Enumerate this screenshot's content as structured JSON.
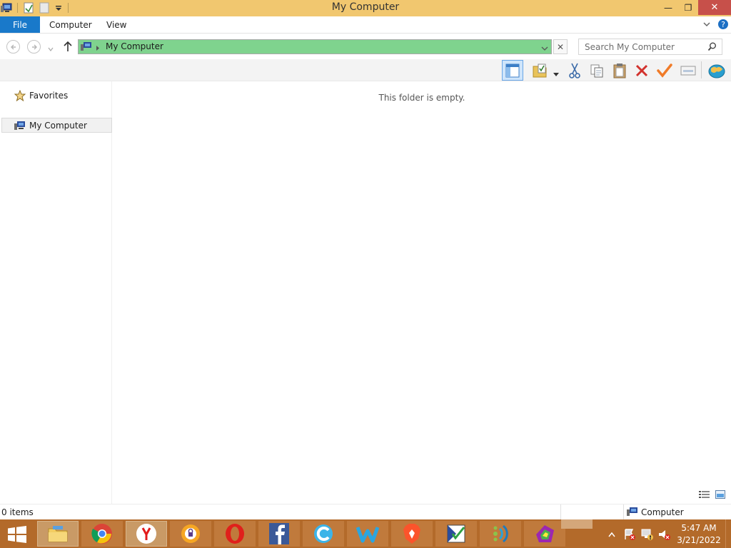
{
  "window": {
    "title": "My Computer",
    "minimize": "—",
    "restore": "❐",
    "close": "✕"
  },
  "ribbon": {
    "tabs": [
      "File",
      "Computer",
      "View"
    ]
  },
  "address": {
    "path": "My Computer",
    "clear": "✕"
  },
  "search": {
    "placeholder": "Search My Computer"
  },
  "nav_pane": {
    "items": [
      "Favorites",
      "My Computer"
    ]
  },
  "content": {
    "empty_message": "This folder is empty."
  },
  "status": {
    "count": "0 items",
    "zone": "Computer"
  },
  "tray": {
    "time": "5:47 AM",
    "date": "3/21/2022"
  },
  "colors": {
    "titlebar": "#f1c76f",
    "file_tab": "#1979ca",
    "address_bar": "#7fd38e",
    "taskbar": "#b36a2a",
    "close_button": "#c7504a"
  },
  "taskbar_apps": [
    "file-explorer",
    "chrome",
    "yandex",
    "pinned-app-shield",
    "opera",
    "facebook",
    "app-c",
    "app-w",
    "brave",
    "app-checklist",
    "app-waves",
    "app-colorful"
  ]
}
